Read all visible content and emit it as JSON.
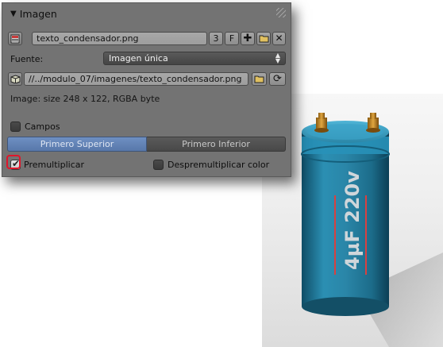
{
  "panel": {
    "title": "Imagen",
    "image_name": "texto_condensador.png",
    "users_count": "3",
    "fake_user_label": "F",
    "source_label": "Fuente:",
    "source_value": "Imagen única",
    "filepath": "//../modulo_07/imagenes/texto_condensador.png",
    "image_info": "Image: size 248 x 122, RGBA byte",
    "fields_label": "Campos",
    "field_order": {
      "upper_label": "Primero Superior",
      "lower_label": "Primero Inferior",
      "selected": "Primero Superior"
    },
    "premultiply_label": "Premultiplicar",
    "premultiply_checked": true,
    "unpremultiply_label": "Despremultiplicar color",
    "unpremultiply_checked": false
  },
  "render": {
    "label_text": "4µF 220v"
  },
  "colors": {
    "panel_bg": "#737373",
    "highlight": "#e0162b",
    "capacitor_body": "#2b87a8",
    "capacitor_label": "#d94040"
  }
}
